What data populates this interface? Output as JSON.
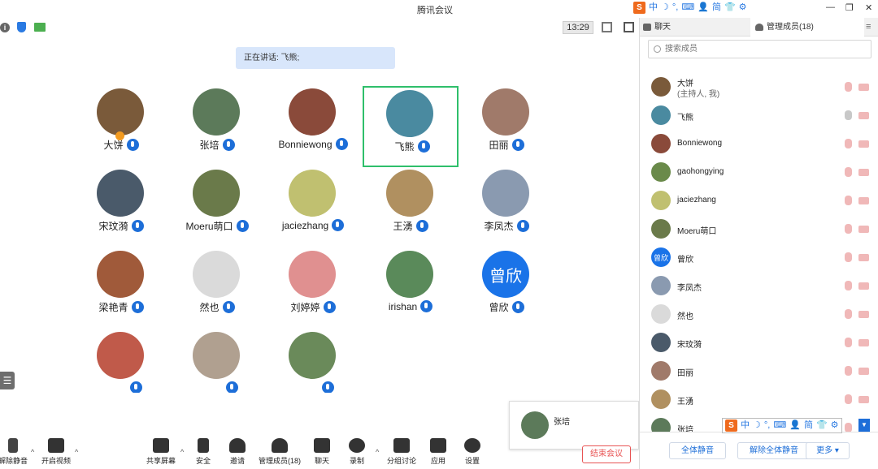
{
  "window": {
    "title": "腾讯会议",
    "controls": [
      "—",
      "❐",
      "✕"
    ]
  },
  "ime": {
    "logo": "S",
    "items": [
      "中",
      "☽",
      "°,",
      "⌨",
      "👤",
      "简",
      "👕",
      "⚙"
    ]
  },
  "meeting": {
    "time": "13:29",
    "speaking_text": "正在讲话: 飞熊;"
  },
  "participants": [
    {
      "name": "大饼",
      "host": true,
      "color": "#7a5a3a"
    },
    {
      "name": "张培",
      "color": "#5c7a5a"
    },
    {
      "name": "Bonniewong",
      "color": "#8a4a3a"
    },
    {
      "name": "飞熊",
      "color": "#4a8aa0",
      "active": true
    },
    {
      "name": "田丽",
      "color": "#a07a6a"
    },
    {
      "name": "宋玟漪",
      "color": "#4a5a6a"
    },
    {
      "name": "Moeru萌口",
      "color": "#6a7a4a"
    },
    {
      "name": "jaciezhang",
      "color": "#c0c070"
    },
    {
      "name": "王湧",
      "color": "#b09060"
    },
    {
      "name": "李凤杰",
      "color": "#8a9ab0"
    },
    {
      "name": "梁艳青",
      "color": "#a05a3a"
    },
    {
      "name": "然也",
      "color": "#dadada"
    },
    {
      "name": "刘婷婷",
      "color": "#e09090"
    },
    {
      "name": "irishan",
      "color": "#5a8a5a"
    },
    {
      "name": "曾欣",
      "text_avatar": "曾欣",
      "color": "#1a73e8"
    },
    {
      "name": "",
      "color": "#c05a4a",
      "partial": true
    },
    {
      "name": "",
      "color": "#b0a090",
      "partial": true
    },
    {
      "name": "",
      "color": "#6a8a5a",
      "partial": true
    }
  ],
  "self_view": {
    "name": "张培",
    "color": "#5c7a5a"
  },
  "toolbar": {
    "unmute": "解除静音",
    "start_video": "开启视频",
    "share": "共享屏幕",
    "security": "安全",
    "invite": "邀请",
    "members": "管理成员(18)",
    "chat": "聊天",
    "record": "录制",
    "breakout": "分组讨论",
    "apps": "应用",
    "settings": "设置",
    "end": "结束会议"
  },
  "panel": {
    "tab_chat": "聊天",
    "tab_members": "管理成员(18)",
    "search_placeholder": "搜索成员",
    "members": [
      {
        "name": "大饼",
        "sub": "(主持人, 我)",
        "color": "#7a5a3a"
      },
      {
        "name": "飞熊",
        "color": "#4a8aa0",
        "mic_on": true
      },
      {
        "name": "Bonniewong",
        "color": "#8a4a3a"
      },
      {
        "name": "gaohongying",
        "color": "#6a8a4a"
      },
      {
        "name": "jaciezhang",
        "color": "#c0c070"
      },
      {
        "name": "Moeru萌口",
        "color": "#6a7a4a"
      },
      {
        "name": "曾欣",
        "text_avatar": "曾欣",
        "color": "#1a73e8"
      },
      {
        "name": "李凤杰",
        "color": "#8a9ab0"
      },
      {
        "name": "然也",
        "color": "#dadada"
      },
      {
        "name": "宋玟漪",
        "color": "#4a5a6a"
      },
      {
        "name": "田丽",
        "color": "#a07a6a"
      },
      {
        "name": "王湧",
        "color": "#b09060"
      },
      {
        "name": "张培",
        "color": "#5c7a5a"
      }
    ],
    "footer": {
      "mute_all": "全体静音",
      "unmute_all": "解除全体静音",
      "more": "更多 ▾"
    }
  }
}
